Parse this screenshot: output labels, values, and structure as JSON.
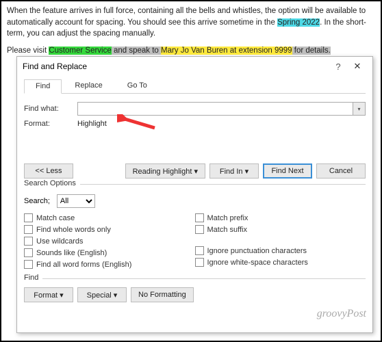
{
  "doc": {
    "p1a": "When the feature arrives in full force, containing all the bells and whistles, the option will be available to automatically account for spacing. You should see this arrive sometime in the ",
    "p1_hl": "Spring 2022",
    "p1b": ". In the short-term, you can adjust the spacing manually.",
    "p2a": "Please visit ",
    "p2_hl1": "Customer Service",
    "p2b": " and speak to ",
    "p2_hl2": "Mary Jo Van Buren at extension 9999",
    "p2c": " for details."
  },
  "dialog": {
    "title": "Find and Replace",
    "help": "?",
    "close": "✕",
    "tabs": {
      "find": "Find",
      "replace": "Replace",
      "goto": "Go To"
    },
    "find_what_label": "Find what:",
    "format_label": "Format:",
    "format_value": "Highlight",
    "buttons": {
      "less": "<<  Less",
      "reading": "Reading Highlight ▾",
      "find_in": "Find In ▾",
      "find_next": "Find Next",
      "cancel": "Cancel",
      "format": "Format ▾",
      "special": "Special ▾",
      "no_formatting": "No Formatting"
    },
    "options": {
      "title": "Search Options",
      "search_label": "Search;",
      "search_value": "All",
      "left": {
        "match_case": "Match case",
        "whole_words": "Find whole words only",
        "wildcards": "Use wildcards",
        "sounds_like": "Sounds like (English)",
        "word_forms": "Find all word forms (English)"
      },
      "right": {
        "match_prefix": "Match prefix",
        "match_suffix": "Match suffix",
        "ignore_punct": "Ignore punctuation characters",
        "ignore_ws": "Ignore white-space characters"
      }
    },
    "findtitle": "Find"
  },
  "watermark": "groovyPost"
}
